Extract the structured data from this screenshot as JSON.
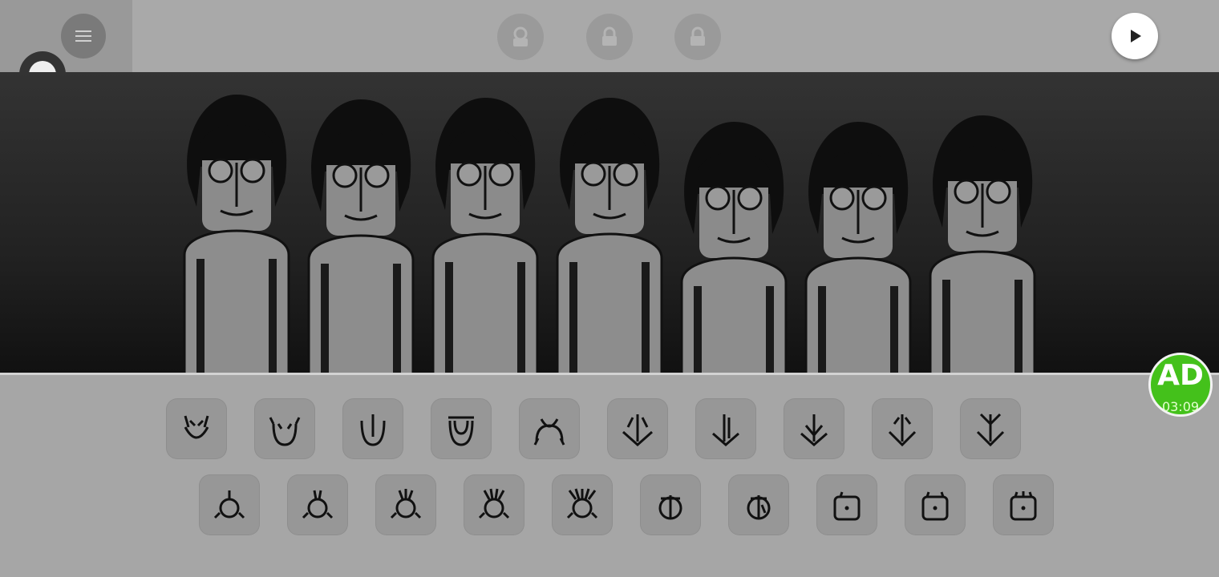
{
  "topbar": {
    "menu_icon": "hamburger-icon",
    "mode_buttons": [
      {
        "icon": "person-lock-icon"
      },
      {
        "icon": "lock-icon"
      },
      {
        "icon": "lock-icon"
      }
    ],
    "play_icon": "play-icon"
  },
  "stage": {
    "characters": [
      {
        "name": "character-1"
      },
      {
        "name": "character-2"
      },
      {
        "name": "character-3"
      },
      {
        "name": "character-4"
      },
      {
        "name": "character-5"
      },
      {
        "name": "character-6"
      },
      {
        "name": "character-7"
      }
    ]
  },
  "sounds": {
    "row1": [
      "horseshoe-horns-a",
      "horseshoe-horns-b",
      "horseshoe-pin",
      "horseshoe-arch",
      "horseshoe-curl",
      "down-arrow-a",
      "down-arrow-b",
      "down-arrow-c",
      "down-arrow-d",
      "down-arrow-e"
    ],
    "row2": [
      "antenna-a",
      "antenna-b",
      "antenna-c",
      "antenna-d",
      "antenna-e",
      "split-circle-a",
      "split-circle-b",
      "box-dot-a",
      "box-dot-b",
      "box-dot-c"
    ]
  },
  "ad": {
    "label": "AD",
    "timer": "03:09",
    "color": "#44c11b"
  },
  "colors": {
    "background": "#a6a6a6",
    "stage_top": "#333333",
    "stage_bottom": "#111111"
  }
}
